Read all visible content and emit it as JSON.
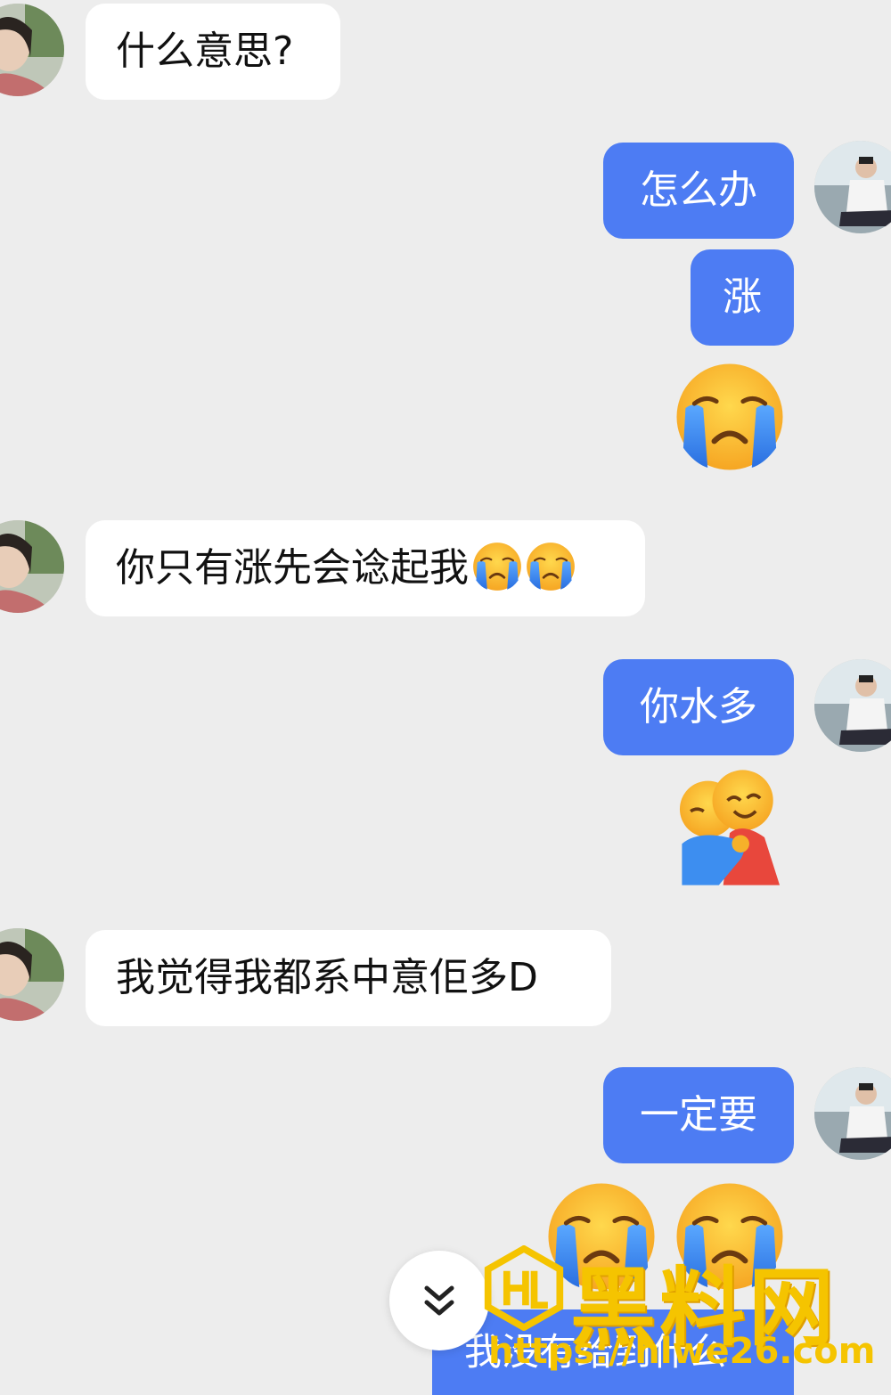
{
  "messages": [
    {
      "side": "in",
      "type": "text",
      "text": "什么意思?"
    },
    {
      "side": "out",
      "type": "text",
      "text": "怎么办"
    },
    {
      "side": "out",
      "type": "text",
      "text": "涨"
    },
    {
      "side": "out",
      "type": "emoji",
      "emoji": "loudly-crying-face"
    },
    {
      "side": "in",
      "type": "text",
      "text": "你只有涨先会谂起我",
      "trailing_emoji": [
        "loudly-crying-face",
        "loudly-crying-face"
      ]
    },
    {
      "side": "out",
      "type": "text",
      "text": "你水多"
    },
    {
      "side": "out",
      "type": "emoji",
      "emoji": "people-hugging"
    },
    {
      "side": "in",
      "type": "text",
      "text": "我觉得我都系中意佢多D"
    },
    {
      "side": "out",
      "type": "text",
      "text": "一定要"
    },
    {
      "side": "out",
      "type": "emoji",
      "emoji": "loudly-crying-face-pair"
    },
    {
      "side": "out",
      "type": "text",
      "text": "我没有给到什么",
      "partially_hidden": true
    }
  ],
  "scroll_button": {
    "icon": "double-chevron-down-icon"
  },
  "watermark": {
    "text": "黑料网",
    "url": "https://hlwe26.com"
  },
  "colors": {
    "background": "#ededed",
    "incoming_bubble": "#ffffff",
    "outgoing_bubble": "#4d7cf3",
    "watermark": "#f5c400"
  }
}
